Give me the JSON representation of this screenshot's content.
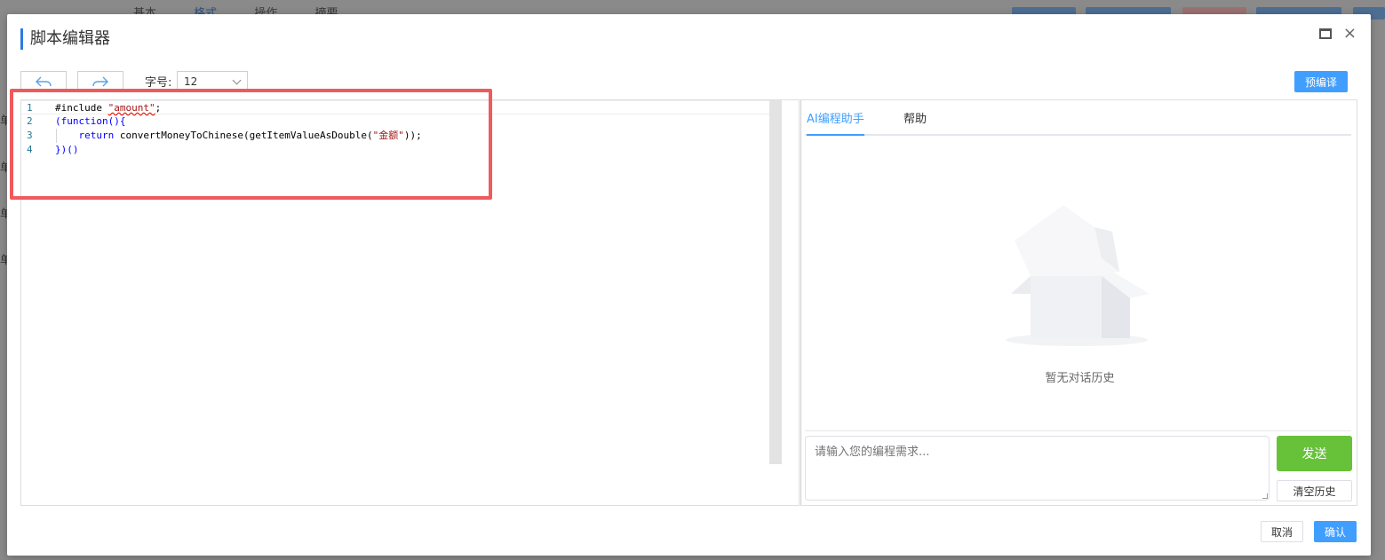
{
  "background": {
    "tabs": [
      "基本",
      "格式",
      "操作",
      "摘要"
    ],
    "side_chars": [
      "单",
      "单",
      "单",
      "单"
    ]
  },
  "dialog": {
    "title": "脚本编辑器",
    "max_icon": "maximize-icon",
    "close_icon": "×"
  },
  "toolbar": {
    "undo_icon": "undo-icon",
    "redo_icon": "redo-icon",
    "font_size_label": "字号:",
    "font_size_value": "12",
    "precompile_label": "预编译"
  },
  "editor": {
    "lines": [
      {
        "num": "1",
        "text": "#include \"amount\";"
      },
      {
        "num": "2",
        "text": "(function(){"
      },
      {
        "num": "3",
        "text": "    return convertMoneyToChinese(getItemValueAsDouble(\"金额\"));"
      },
      {
        "num": "4",
        "text": "})()"
      }
    ]
  },
  "ai_panel": {
    "tabs": [
      "AI编程助手",
      "帮助"
    ],
    "active_tab": 0,
    "empty_text": "暂无对话历史",
    "input_placeholder": "请输入您的编程需求...",
    "send_label": "发送",
    "clear_label": "清空历史"
  },
  "footer": {
    "cancel_label": "取消",
    "confirm_label": "确认"
  },
  "colors": {
    "accent": "#409eff",
    "title_bar": "#2f7be0",
    "send": "#67c23a",
    "highlight": "#ef5a5e"
  }
}
